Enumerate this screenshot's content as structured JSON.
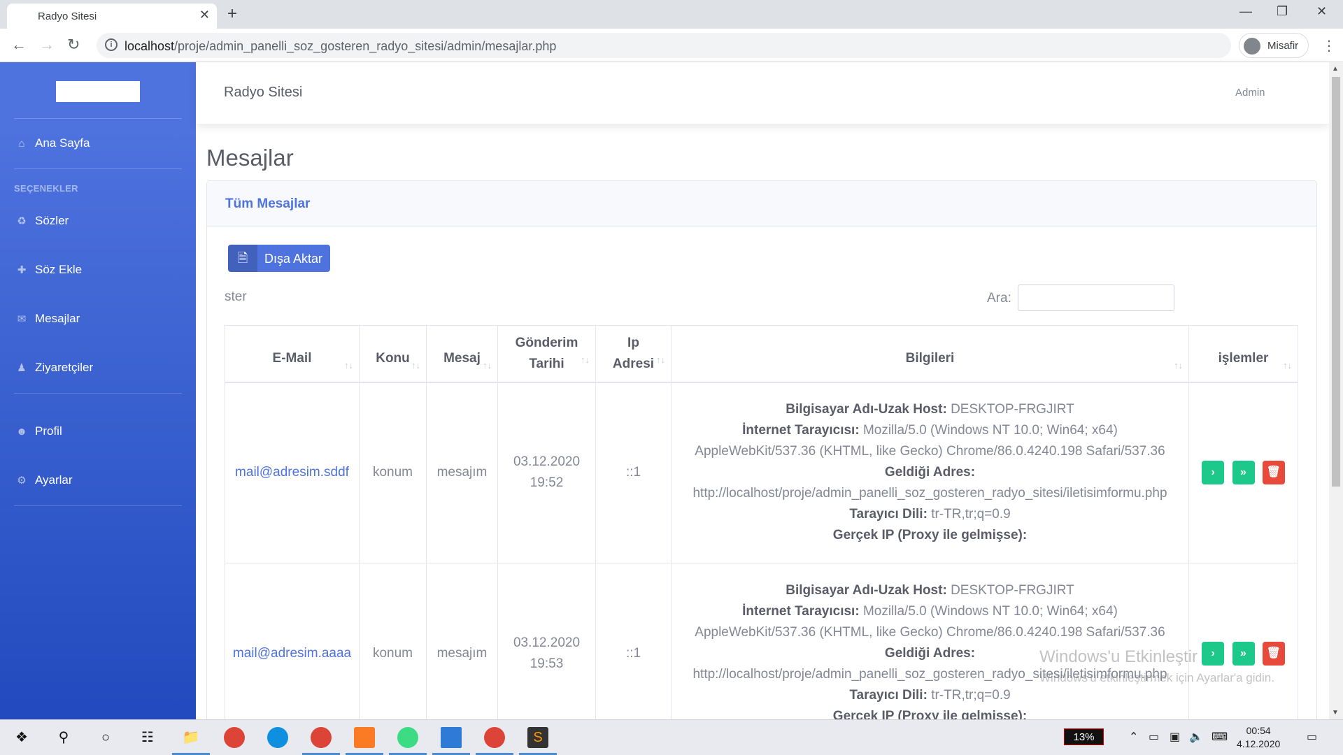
{
  "browser": {
    "tab_title": "Radyo Sitesi",
    "tab_close": "✕",
    "new_tab": "+",
    "url_host": "localhost",
    "url_path": "/proje/admin_panelli_soz_gosteren_radyo_sitesi/admin/mesajlar.php",
    "profile": "Misafir"
  },
  "sidebar": {
    "items": [
      {
        "label": "Ana Sayfa",
        "icon": "home-icon"
      },
      {
        "label": "Sözler",
        "icon": "cart-icon"
      },
      {
        "label": "Söz Ekle",
        "icon": "plus-icon"
      },
      {
        "label": "Mesajlar",
        "icon": "envelope-icon"
      },
      {
        "label": "Ziyaretçiler",
        "icon": "user-icon"
      },
      {
        "label": "Profil",
        "icon": "user-circle-icon"
      },
      {
        "label": "Ayarlar",
        "icon": "gear-icon"
      }
    ],
    "heading": "SEÇENEKLER"
  },
  "topbar": {
    "title": "Radyo Sitesi",
    "user": "Admin"
  },
  "page": {
    "heading": "Mesajlar",
    "card_title": "Tüm Mesajlar",
    "export_label": "Dışa Aktar",
    "show_label": "ster",
    "search_label": "Ara:"
  },
  "table": {
    "headers": {
      "email": "E-Mail",
      "konu": "Konu",
      "mesaj": "Mesaj",
      "tarih_1": "Gönderim",
      "tarih_2": "Tarihi",
      "ip_1": "Ip",
      "ip_2": "Adresi",
      "bilgi": "Bilgileri",
      "islem": "işlemler"
    },
    "info_labels": {
      "host": "Bilgisayar Adı-Uzak Host:",
      "browser": "İnternet Tarayıcısı:",
      "referer": "Geldiği Adres:",
      "lang": "Tarayıcı Dili:",
      "real_ip": "Gerçek IP (Proxy ile gelmişse):"
    },
    "rows": [
      {
        "email": "mail@adresim.sddf",
        "konu": "konum",
        "mesaj": "mesajım",
        "date": "03.12.2020",
        "time": "19:52",
        "ip": "::1",
        "host": "DESKTOP-FRGJIRT",
        "ua_1": "Mozilla/5.0 (Windows NT 10.0; Win64; x64)",
        "ua_2": "AppleWebKit/537.36 (KHTML, like Gecko) Chrome/86.0.4240.198 Safari/537.36",
        "referer": "http://localhost/proje/admin_panelli_soz_gosteren_radyo_sitesi/iletisimformu.php",
        "lang": "tr-TR,tr;q=0.9",
        "real_ip": ""
      },
      {
        "email": "mail@adresim.aaaa",
        "konu": "konum",
        "mesaj": "mesajım",
        "date": "03.12.2020",
        "time": "19:53",
        "ip": "::1",
        "host": "DESKTOP-FRGJIRT",
        "ua_1": "Mozilla/5.0 (Windows NT 10.0; Win64; x64)",
        "ua_2": "AppleWebKit/537.36 (KHTML, like Gecko) Chrome/86.0.4240.198 Safari/537.36",
        "referer": "http://localhost/proje/admin_panelli_soz_gosteren_radyo_sitesi/iletisimformu.php",
        "lang": "tr-TR,tr;q=0.9",
        "real_ip": ""
      }
    ]
  },
  "watermark": {
    "line1": "Windows'u Etkinleştir",
    "line2": "Windows'u etkinleştirmek için Ayarlar'a gidin."
  },
  "taskbar": {
    "battery": "13%",
    "time": "00:54",
    "date": "4.12.2020"
  },
  "colors": {
    "primary": "#4e73df",
    "success": "#1cc88a",
    "danger": "#e74a3b"
  }
}
